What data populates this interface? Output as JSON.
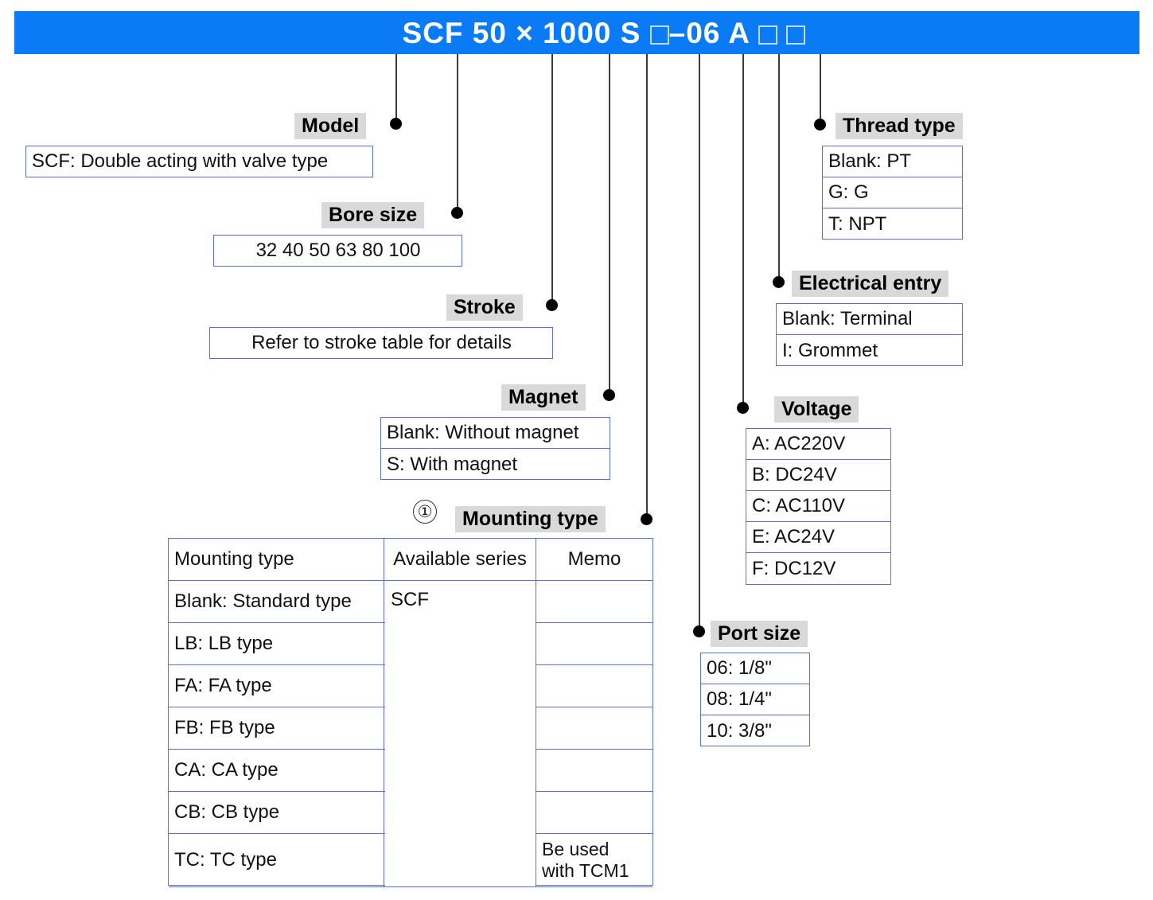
{
  "header": {
    "code_parts": [
      {
        "type": "text",
        "value": "SCF"
      },
      {
        "type": "text",
        "value": " 50 "
      },
      {
        "type": "text",
        "value": "×"
      },
      {
        "type": "text",
        "value": " 1000 S "
      },
      {
        "type": "box"
      },
      {
        "type": "text",
        "value": "–06 A "
      },
      {
        "type": "box"
      },
      {
        "type": "text",
        "value": " "
      },
      {
        "type": "box"
      }
    ],
    "code_plain": "SCF 50 × 1000 S □–06 A □ □",
    "bar_color": "#0b7bf5",
    "text_color": "#ffffff"
  },
  "colors": {
    "label_background": "#d9d9d9",
    "box_border": "#5b6fd6",
    "leader_line": "#3a3a3a",
    "dot": "#000000"
  },
  "sections": {
    "model": {
      "label": "Model",
      "options": [
        "SCF: Double acting with valve type"
      ]
    },
    "bore_size": {
      "label": "Bore size",
      "options": [
        "32  40  50  63  80  100"
      ],
      "values": [
        32,
        40,
        50,
        63,
        80,
        100
      ]
    },
    "stroke": {
      "label": "Stroke",
      "options": [
        "Refer to stroke table for details"
      ]
    },
    "magnet": {
      "label": "Magnet",
      "options": [
        "Blank: Without magnet",
        "S: With magnet"
      ]
    },
    "mounting_type": {
      "label": "Mounting type",
      "note_marker": "①",
      "columns": [
        "Mounting type",
        "Available series",
        "Memo"
      ],
      "available_series": "SCF",
      "rows": [
        {
          "type": "Blank: Standard type",
          "memo": ""
        },
        {
          "type": "LB: LB type",
          "memo": ""
        },
        {
          "type": "FA: FA type",
          "memo": ""
        },
        {
          "type": "FB: FB type",
          "memo": ""
        },
        {
          "type": "CA: CA type",
          "memo": ""
        },
        {
          "type": "CB: CB type",
          "memo": ""
        },
        {
          "type": "TC: TC type",
          "memo": "Be used\nwith TCM1"
        }
      ]
    },
    "port_size": {
      "label": "Port size",
      "options": [
        "06: 1/8\"",
        "08: 1/4\"",
        "10: 3/8\""
      ]
    },
    "voltage": {
      "label": "Voltage",
      "options": [
        "A: AC220V",
        "B: DC24V",
        "C: AC110V",
        "E: AC24V",
        "F: DC12V"
      ]
    },
    "electrical_entry": {
      "label": "Electrical entry",
      "options": [
        "Blank: Terminal",
        "I: Grommet"
      ]
    },
    "thread_type": {
      "label": "Thread type",
      "options": [
        "Blank: PT",
        "G: G",
        "T: NPT"
      ]
    }
  }
}
